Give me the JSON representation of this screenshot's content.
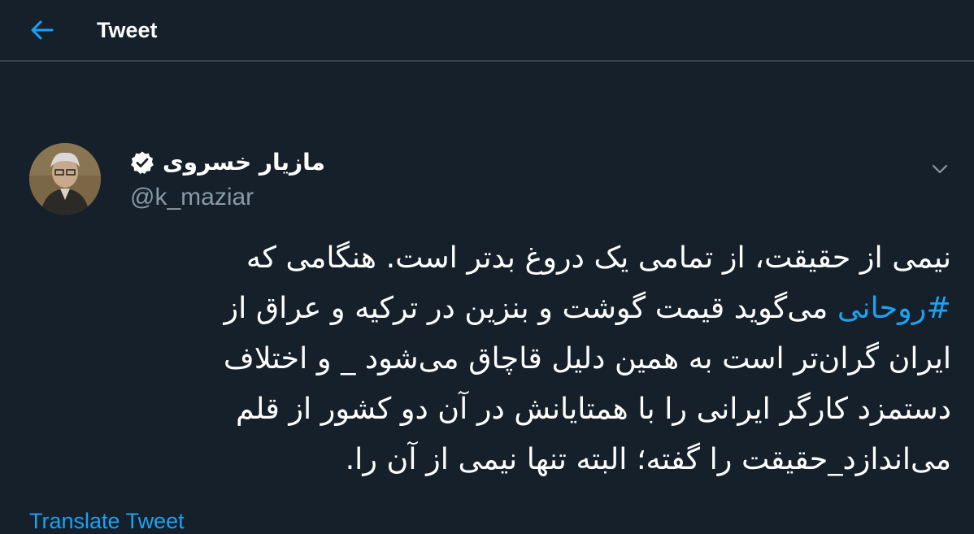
{
  "header": {
    "title": "Tweet"
  },
  "colors": {
    "background": "#15202b",
    "accent": "#1da1f2",
    "muted": "#8899a6",
    "divider": "#38444d"
  },
  "tweet": {
    "author": {
      "display_name": "مازیار خسروی",
      "handle": "@k_maziar",
      "verified": true
    },
    "text_lines": [
      {
        "text": "نیمی از حقیقت، از تمامی یک دروغ بدتر است. هنگامی که"
      },
      {
        "hashtag": "#روحانی",
        "text": " می‌گوید قیمت گوشت و بنزین در ترکیه و عراق از"
      },
      {
        "text": "ایران گران‌تر است به همین دلیل قاچاق می‌شود _ و اختلاف"
      },
      {
        "text": "دستمزد کارگر ایرانی را با همتایانش در آن دو کشور از قلم"
      },
      {
        "text": "می‌اندازد_حقیقت را گفته؛ البته تنها نیمی از آن را."
      }
    ],
    "translate_label": "Translate Tweet"
  },
  "icons": {
    "back": "arrow-left-icon",
    "verified": "verified-badge-icon",
    "more": "chevron-down-icon"
  }
}
